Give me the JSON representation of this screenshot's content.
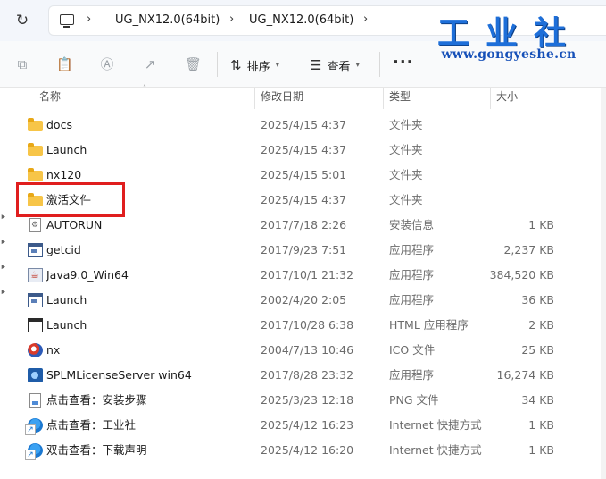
{
  "breadcrumbs": [
    "UG_NX12.0(64bit)",
    "UG_NX12.0(64bit)"
  ],
  "logo": {
    "title": "工业社",
    "url": "www.gongyeshe.cn"
  },
  "toolbar": {
    "sort_label": "排序",
    "view_label": "查看",
    "more_label": "···"
  },
  "columns": {
    "name": "名称",
    "date": "修改日期",
    "type": "类型",
    "size": "大小"
  },
  "files": [
    {
      "name": "docs",
      "date": "2025/4/15 4:37",
      "type": "文件夹",
      "size": "",
      "icon": "folder-icon"
    },
    {
      "name": "Launch",
      "date": "2025/4/15 4:37",
      "type": "文件夹",
      "size": "",
      "icon": "folder-icon"
    },
    {
      "name": "nx120",
      "date": "2025/4/15 5:01",
      "type": "文件夹",
      "size": "",
      "icon": "folder-icon"
    },
    {
      "name": "激活文件",
      "date": "2025/4/15 4:37",
      "type": "文件夹",
      "size": "",
      "icon": "folder-icon"
    },
    {
      "name": "AUTORUN",
      "date": "2017/7/18 2:26",
      "type": "安装信息",
      "size": "1 KB",
      "icon": "setup-info-icon"
    },
    {
      "name": "getcid",
      "date": "2017/9/23 7:51",
      "type": "应用程序",
      "size": "2,237 KB",
      "icon": "application-icon"
    },
    {
      "name": "Java9.0_Win64",
      "date": "2017/10/1 21:32",
      "type": "应用程序",
      "size": "384,520 KB",
      "icon": "java-icon"
    },
    {
      "name": "Launch",
      "date": "2002/4/20 2:05",
      "type": "应用程序",
      "size": "36 KB",
      "icon": "application-icon"
    },
    {
      "name": "Launch",
      "date": "2017/10/28 6:38",
      "type": "HTML 应用程序",
      "size": "2 KB",
      "icon": "window-icon"
    },
    {
      "name": "nx",
      "date": "2004/7/13 10:46",
      "type": "ICO 文件",
      "size": "25 KB",
      "icon": "ico-file-icon"
    },
    {
      "name": "SPLMLicenseServer win64",
      "date": "2017/8/28 23:32",
      "type": "应用程序",
      "size": "16,274 KB",
      "icon": "license-server-icon"
    },
    {
      "name": "点击查看：安装步骤",
      "date": "2025/3/23 12:18",
      "type": "PNG 文件",
      "size": "34 KB",
      "icon": "png-file-icon"
    },
    {
      "name": "点击查看：工业社",
      "date": "2025/4/12 16:23",
      "type": "Internet 快捷方式",
      "size": "1 KB",
      "icon": "internet-shortcut-icon"
    },
    {
      "name": "双击查看：下载声明",
      "date": "2025/4/12 16:20",
      "type": "Internet 快捷方式",
      "size": "1 KB",
      "icon": "internet-shortcut-icon"
    }
  ],
  "colors": {
    "highlight_box": "#e01e1e",
    "folder": "#f7c548",
    "accent": "#1e6fd9"
  }
}
